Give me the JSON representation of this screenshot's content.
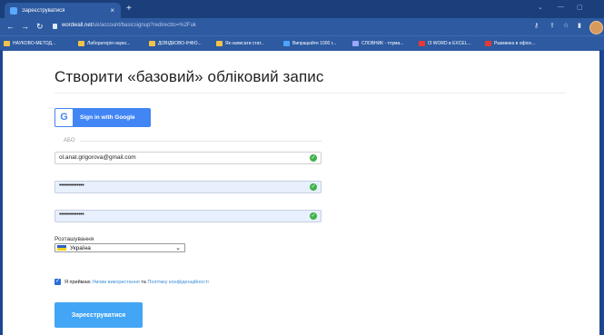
{
  "browser": {
    "tab_title": "Зареєструватися",
    "tab_close": "×",
    "new_tab": "+",
    "url_host": "wordwall.net",
    "url_path": "/uk/account/basicsignup?redirectto=%2Fuk",
    "bookmarks": [
      {
        "label": "НАУКОВО-МЕТОД...",
        "icon": "folder-icon",
        "color": "#f2c34b"
      },
      {
        "label": "Лабораторія науко...",
        "icon": "folder-icon",
        "color": "#f2c34b"
      },
      {
        "label": "ДОВІДКОВО-ІНФО...",
        "icon": "bookmark-icon",
        "color": "#f2c34b"
      },
      {
        "label": "Як написати стат...",
        "icon": "document-icon",
        "color": "#f2c34b"
      },
      {
        "label": "Випрацюйте 1000 г...",
        "icon": "globe-icon",
        "color": "#4fa3ff"
      },
      {
        "label": "СЛОВНИК - тлума...",
        "icon": "dictionary-icon",
        "color": "#9aa7ff"
      },
      {
        "label": "ІЗ WORD в EXCEL...",
        "icon": "youtube-icon",
        "color": "#e53935"
      },
      {
        "label": "Разминка в офісе...",
        "icon": "youtube-icon",
        "color": "#e53935"
      }
    ]
  },
  "page": {
    "title": "Створити «базовий» обліковий запис",
    "google_button": "Sign in with Google",
    "google_letter": "G",
    "or_label": "АБО",
    "email_value": "ol.anat.grigorova@gmail.com",
    "password_mask": "••••••••••••••",
    "confirm_mask": "••••••••••••••",
    "location_label": "Розташування",
    "country_value": "Україна",
    "terms_prefix": "Я приймаю",
    "terms_link": "Умови використання",
    "terms_and": "та",
    "privacy_link": "Політику конфіденційності",
    "submit_label": "Зареєструватися"
  },
  "colors": {
    "accent": "#42a5f5",
    "google_blue": "#4285f4",
    "valid_green": "#3fb14a",
    "browser_frame": "#2d5aa1"
  }
}
